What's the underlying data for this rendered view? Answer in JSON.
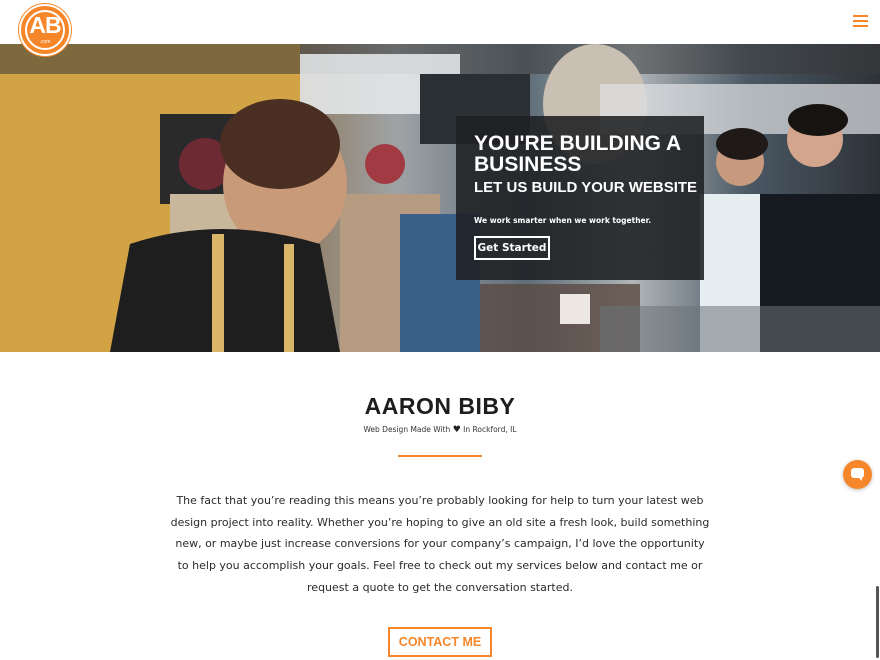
{
  "header": {
    "logo": {
      "text": "AB",
      "subtext": ".com"
    },
    "menu_icon": "hamburger-menu-icon",
    "accent_color": "#f5872a"
  },
  "hero": {
    "headline": "YOU'RE BUILDING A BUSINESS",
    "subheadline": "LET US BUILD YOUR WEBSITE",
    "tagline": "We work smarter when we work together.",
    "cta_label": "Get Started"
  },
  "about": {
    "name": "AARON BIBY",
    "tagline_before": "Web Design Made With",
    "tagline_icon": "heart-icon",
    "tagline_after": "In Rockford, IL",
    "intro": "The fact that you’re reading this means you’re probably looking for help to turn your latest web design project into reality.  Whether you’re hoping to give an old site a fresh look, build something new, or maybe just increase conversions for your company’s campaign, I’d love the opportunity to help you accomplish your goals.  Feel free to check out my services below and contact me or request a quote to get the conversation started.",
    "contact_label": "CONTACT ME"
  },
  "chat_widget": {
    "icon": "chat-bubble-icon"
  }
}
